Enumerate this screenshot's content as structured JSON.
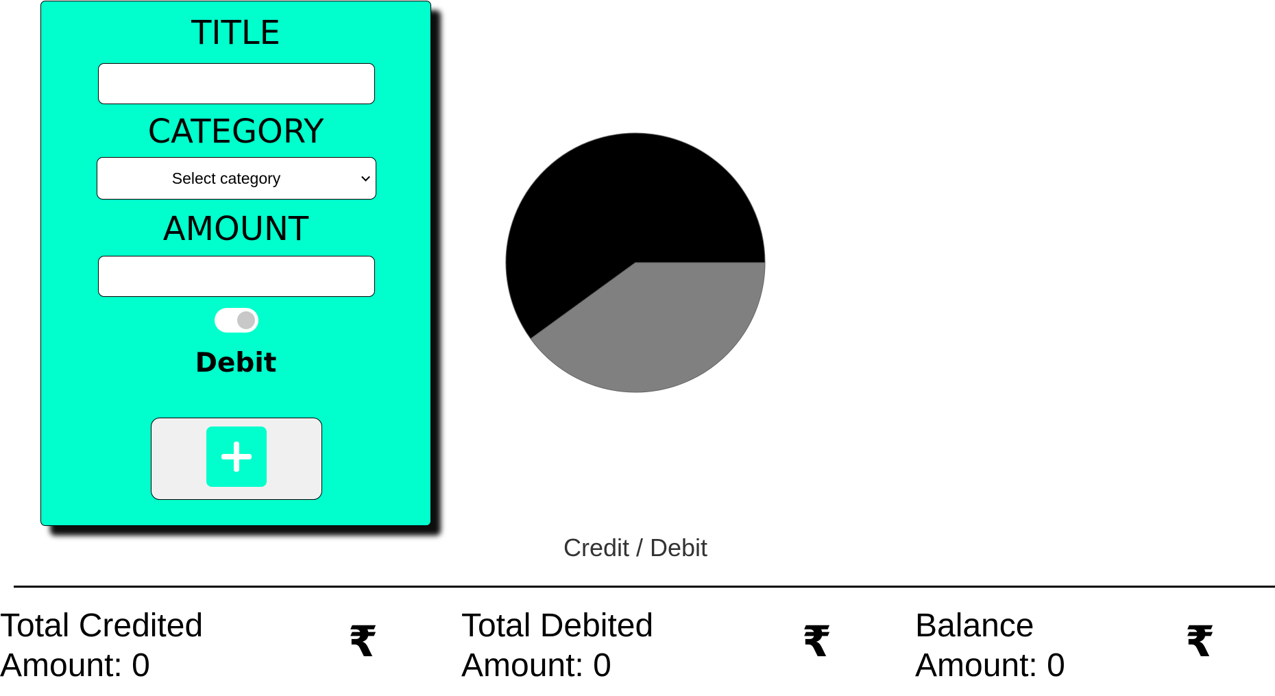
{
  "form": {
    "title_label": "TITLE",
    "title_value": "",
    "category_label": "CATEGORY",
    "category_selected": "Select category",
    "amount_label": "AMOUNT",
    "amount_value": "",
    "mode_label": "Debit",
    "toggle_on": false,
    "accent_color": "#00ffcc",
    "add_icon": "plus-icon"
  },
  "chart_data": {
    "type": "pie",
    "title": "Credit / Debit",
    "series": [
      {
        "value": 60,
        "color": "#000000"
      },
      {
        "value": 40,
        "color": "#808080"
      }
    ]
  },
  "summary": {
    "credited": {
      "line1": "Total Credited",
      "line2": "Amount: 0"
    },
    "debited": {
      "line1": "Total Debited",
      "line2": "Amount: 0"
    },
    "balance": {
      "line1": "Balance",
      "line2": "Amount: 0"
    },
    "currency_symbol": "₹"
  }
}
